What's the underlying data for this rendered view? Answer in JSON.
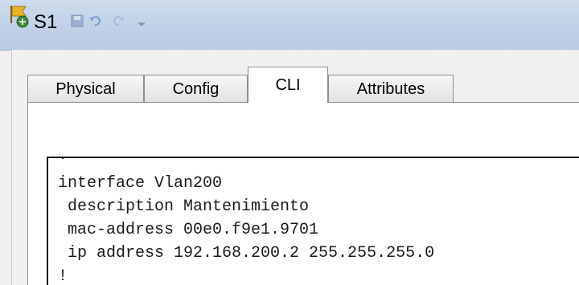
{
  "window": {
    "title": "S1",
    "icon": "switch-device-icon"
  },
  "quick_access": [
    "save-icon",
    "undo-icon",
    "redo-icon",
    "customize-icon"
  ],
  "tabs": [
    {
      "label": "Physical",
      "active": false
    },
    {
      "label": "Config",
      "active": false
    },
    {
      "label": "CLI",
      "active": true
    },
    {
      "label": "Attributes",
      "active": false
    }
  ],
  "cli": {
    "lines": [
      "!",
      "interface Vlan200",
      " description Mantenimiento",
      " mac-address 00e0.f9e1.9701",
      " ip address 192.168.200.2 255.255.255.0",
      "!"
    ]
  },
  "colors": {
    "titlebar": "#c2d3e8",
    "panel_bg": "#ffffff",
    "text": "#1b1b1b"
  }
}
